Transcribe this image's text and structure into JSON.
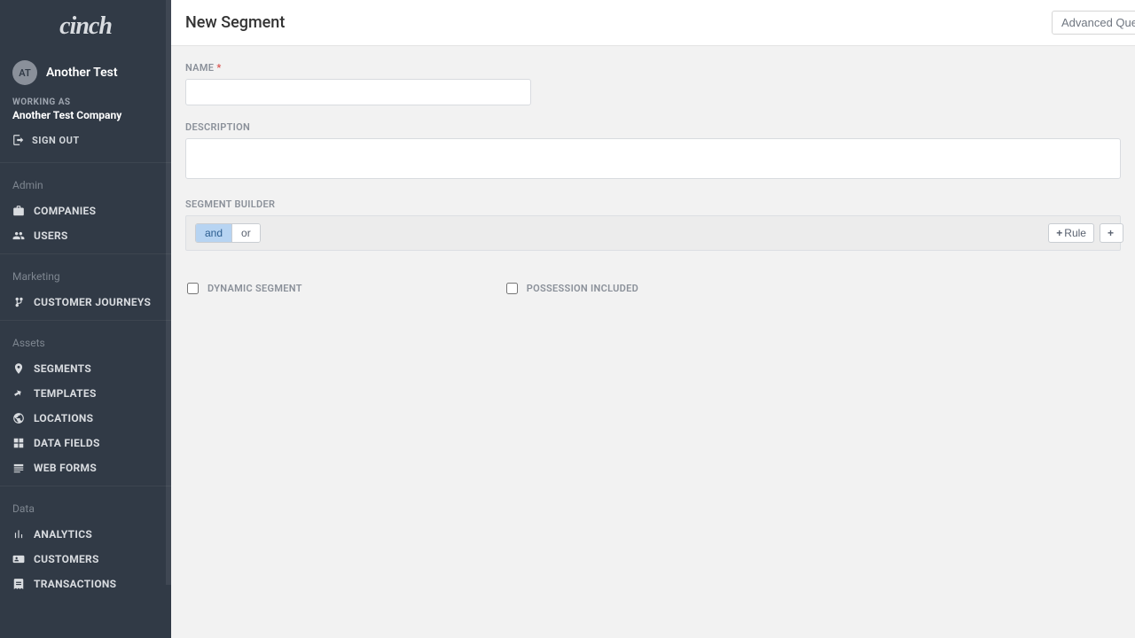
{
  "logo": "cinch",
  "user": {
    "initials": "AT",
    "name": "Another Test"
  },
  "working_as": {
    "label": "WORKING AS",
    "company": "Another Test Company"
  },
  "sign_out": "SIGN OUT",
  "nav": {
    "admin": {
      "title": "Admin",
      "items": [
        {
          "label": "COMPANIES"
        },
        {
          "label": "USERS"
        }
      ]
    },
    "marketing": {
      "title": "Marketing",
      "items": [
        {
          "label": "CUSTOMER JOURNEYS"
        }
      ]
    },
    "assets": {
      "title": "Assets",
      "items": [
        {
          "label": "SEGMENTS"
        },
        {
          "label": "TEMPLATES"
        },
        {
          "label": "LOCATIONS"
        },
        {
          "label": "DATA FIELDS"
        },
        {
          "label": "WEB FORMS"
        }
      ]
    },
    "data": {
      "title": "Data",
      "items": [
        {
          "label": "ANALYTICS"
        },
        {
          "label": "CUSTOMERS"
        },
        {
          "label": "TRANSACTIONS"
        }
      ]
    }
  },
  "header": {
    "title": "New Segment",
    "advanced": "Advanced Que"
  },
  "form": {
    "name_label": "NAME",
    "name_value": "",
    "description_label": "DESCRIPTION",
    "description_value": "",
    "segment_builder_label": "SEGMENT BUILDER",
    "and": "and",
    "or": "or",
    "add_rule": "Rule",
    "plus": "+",
    "dynamic_label": "DYNAMIC SEGMENT",
    "possession_label": "POSSESSION INCLUDED"
  }
}
